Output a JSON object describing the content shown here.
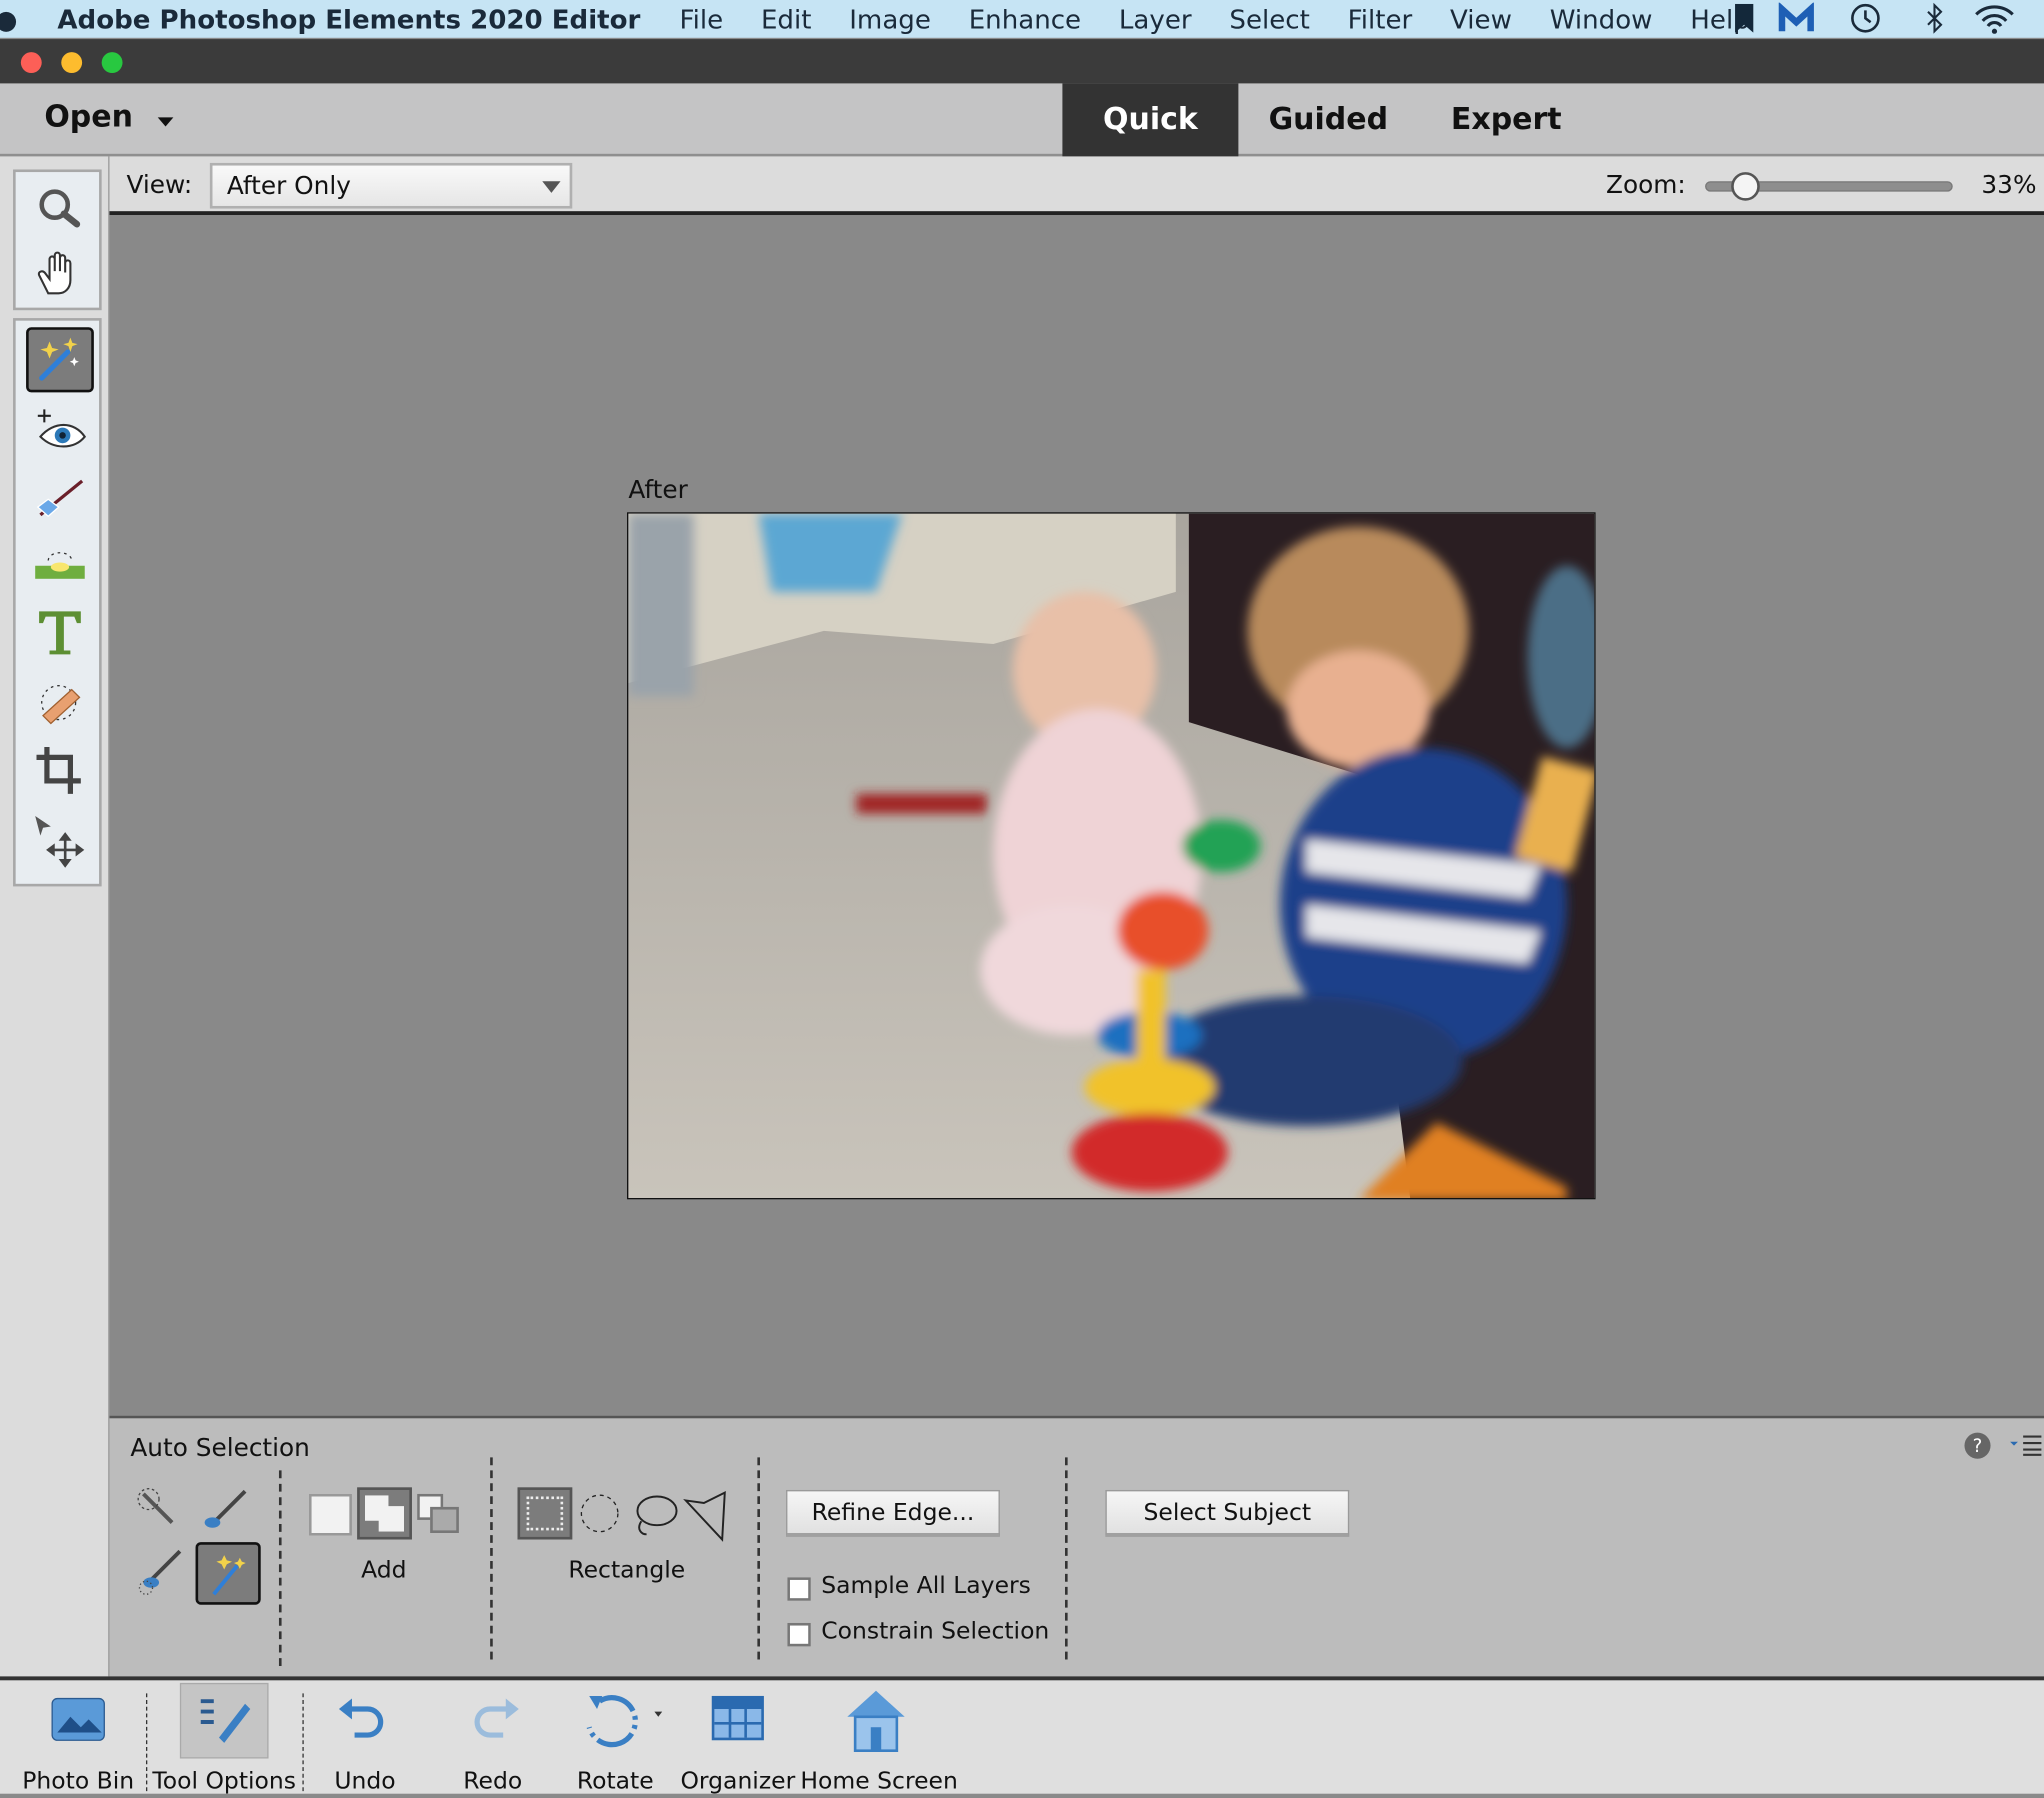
{
  "menubar": {
    "app": "Adobe Photoshop Elements 2020 Editor",
    "items": [
      "File",
      "Edit",
      "Image",
      "Enhance",
      "Layer",
      "Select",
      "Filter",
      "View",
      "Window",
      "Help"
    ],
    "status_icons": [
      "bookmark-icon",
      "malwarebytes-icon",
      "time-machine-icon",
      "bluetooth-icon",
      "wifi-icon"
    ]
  },
  "modebar": {
    "open": "Open",
    "tabs": [
      "Quick",
      "Guided",
      "Expert"
    ],
    "active_tab": "Quick"
  },
  "tools": [
    "zoom-tool",
    "hand-tool",
    "quick-selection-tool",
    "red-eye-tool",
    "whiten-teeth-tool",
    "straighten-tool",
    "type-tool",
    "spot-healing-tool",
    "crop-tool",
    "move-tool"
  ],
  "viewbar": {
    "view_label": "View:",
    "view_value": "After Only",
    "zoom_label": "Zoom:",
    "zoom_value": "33%",
    "zoom_percent": 33
  },
  "canvas": {
    "image_label": "After"
  },
  "options": {
    "title": "Auto Selection",
    "mode_label": "Add",
    "shape_label": "Rectangle",
    "refine_edge": "Refine Edge...",
    "select_subject": "Select Subject",
    "sample_all_layers": "Sample All Layers",
    "sample_all_layers_checked": false,
    "constrain_selection": "Constrain Selection",
    "constrain_selection_checked": false
  },
  "taskbar": {
    "items": [
      "Photo Bin",
      "Tool Options",
      "Undo",
      "Redo",
      "Rotate",
      "Organizer",
      "Home Screen"
    ]
  },
  "colors": {
    "menubar": "#c6e4f4",
    "active_tab": "#333333",
    "canvas": "#898989",
    "accent_blue": "#3a7fc4"
  }
}
